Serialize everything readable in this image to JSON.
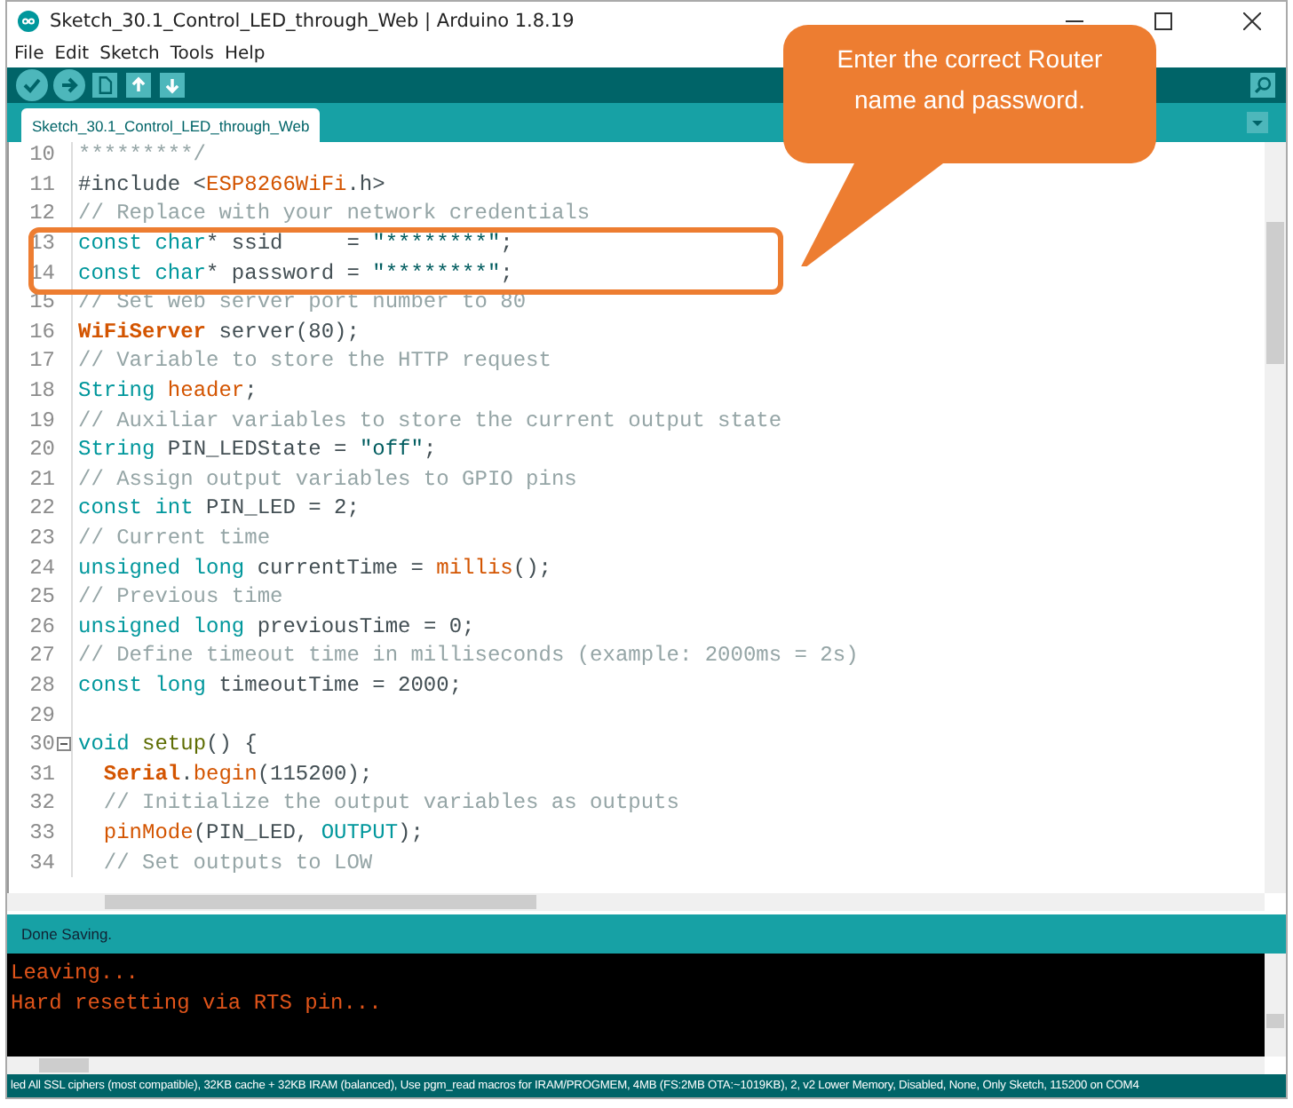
{
  "window": {
    "title": "Sketch_30.1_Control_LED_through_Web | Arduino 1.8.19"
  },
  "menu": [
    "File",
    "Edit",
    "Sketch",
    "Tools",
    "Help"
  ],
  "tabs": [
    {
      "label": "Sketch_30.1_Control_LED_through_Web",
      "selected": true
    }
  ],
  "editor": {
    "lines": [
      {
        "number": "10",
        "segments": [
          {
            "kind": "comment",
            "text": "*********/"
          }
        ]
      },
      {
        "number": "11",
        "segments": [
          {
            "kind": "plain",
            "text": "#include <"
          },
          {
            "kind": "func",
            "text": "ESP8266WiFi"
          },
          {
            "kind": "plain",
            "text": ".h>"
          }
        ]
      },
      {
        "number": "12",
        "segments": [
          {
            "kind": "comment",
            "text": "// Replace with your network credentials"
          }
        ]
      },
      {
        "number": "13",
        "segments": [
          {
            "kind": "type",
            "text": "const char"
          },
          {
            "kind": "plain",
            "text": "* ssid     = "
          },
          {
            "kind": "string",
            "text": "\"********\""
          },
          {
            "kind": "plain",
            "text": ";"
          }
        ]
      },
      {
        "number": "14",
        "segments": [
          {
            "kind": "type",
            "text": "const char"
          },
          {
            "kind": "plain",
            "text": "* password = "
          },
          {
            "kind": "string",
            "text": "\"********\""
          },
          {
            "kind": "plain",
            "text": ";"
          }
        ]
      },
      {
        "number": "15",
        "segments": [
          {
            "kind": "comment",
            "text": "// Set web server port number to 80"
          }
        ]
      },
      {
        "number": "16",
        "segments": [
          {
            "kind": "class",
            "text": "WiFiServer"
          },
          {
            "kind": "plain",
            "text": " server(80);"
          }
        ]
      },
      {
        "number": "17",
        "segments": [
          {
            "kind": "comment",
            "text": "// Variable to store the HTTP request"
          }
        ]
      },
      {
        "number": "18",
        "segments": [
          {
            "kind": "type",
            "text": "String "
          },
          {
            "kind": "func",
            "text": "header"
          },
          {
            "kind": "plain",
            "text": ";"
          }
        ]
      },
      {
        "number": "19",
        "segments": [
          {
            "kind": "comment",
            "text": "// Auxiliar variables to store the current output state"
          }
        ]
      },
      {
        "number": "20",
        "segments": [
          {
            "kind": "type",
            "text": "String"
          },
          {
            "kind": "plain",
            "text": " PIN_LEDState = "
          },
          {
            "kind": "string",
            "text": "\"off\""
          },
          {
            "kind": "plain",
            "text": ";"
          }
        ]
      },
      {
        "number": "21",
        "segments": [
          {
            "kind": "comment",
            "text": "// Assign output variables to GPIO pins"
          }
        ]
      },
      {
        "number": "22",
        "segments": [
          {
            "kind": "type",
            "text": "const int"
          },
          {
            "kind": "plain",
            "text": " PIN_LED = 2;"
          }
        ]
      },
      {
        "number": "23",
        "segments": [
          {
            "kind": "comment",
            "text": "// Current time"
          }
        ]
      },
      {
        "number": "24",
        "segments": [
          {
            "kind": "type",
            "text": "unsigned long"
          },
          {
            "kind": "plain",
            "text": " currentTime = "
          },
          {
            "kind": "func",
            "text": "millis"
          },
          {
            "kind": "plain",
            "text": "();"
          }
        ]
      },
      {
        "number": "25",
        "segments": [
          {
            "kind": "comment",
            "text": "// Previous time"
          }
        ]
      },
      {
        "number": "26",
        "segments": [
          {
            "kind": "type",
            "text": "unsigned long"
          },
          {
            "kind": "plain",
            "text": " previousTime = 0;"
          }
        ]
      },
      {
        "number": "27",
        "segments": [
          {
            "kind": "comment",
            "text": "// Define timeout time in milliseconds (example: 2000ms = 2s)"
          }
        ]
      },
      {
        "number": "28",
        "segments": [
          {
            "kind": "type",
            "text": "const long"
          },
          {
            "kind": "plain",
            "text": " timeoutTime = 2000;"
          }
        ]
      },
      {
        "number": "29"
      },
      {
        "number": "30",
        "fold": true,
        "segments": [
          {
            "kind": "type",
            "text": "void "
          },
          {
            "kind": "setup",
            "text": "setup"
          },
          {
            "kind": "plain",
            "text": "() {"
          }
        ]
      },
      {
        "number": "31",
        "indented": true,
        "segments": [
          {
            "kind": "class",
            "text": "Serial"
          },
          {
            "kind": "plain",
            "text": "."
          },
          {
            "kind": "func",
            "text": "begin"
          },
          {
            "kind": "plain",
            "text": "(115200);"
          }
        ]
      },
      {
        "number": "32",
        "indented": true,
        "segments": [
          {
            "kind": "comment",
            "text": "// Initialize the output variables as outputs"
          }
        ]
      },
      {
        "number": "33",
        "indented": true,
        "segments": [
          {
            "kind": "func",
            "text": "pinMode"
          },
          {
            "kind": "plain",
            "text": "(PIN_LED, "
          },
          {
            "kind": "type",
            "text": "OUTPUT"
          },
          {
            "kind": "plain",
            "text": ");"
          }
        ]
      },
      {
        "number": "34",
        "indented": true,
        "segments": [
          {
            "kind": "comment",
            "text": "// Set outputs to LOW"
          }
        ]
      }
    ]
  },
  "callout": {
    "text": "Enter the correct Router name and password."
  },
  "status": "Done Saving.",
  "console": [
    "Leaving...",
    "Hard resetting via RTS pin..."
  ],
  "board_info": "led All SSL ciphers (most compatible), 32KB cache + 32KB IRAM (balanced), Use pgm_read macros for IRAM/PROGMEM, 4MB (FS:2MB OTA:~1019KB), 2, v2 Lower Memory, Disabled, None, Only Sketch, 115200 on COM4"
}
